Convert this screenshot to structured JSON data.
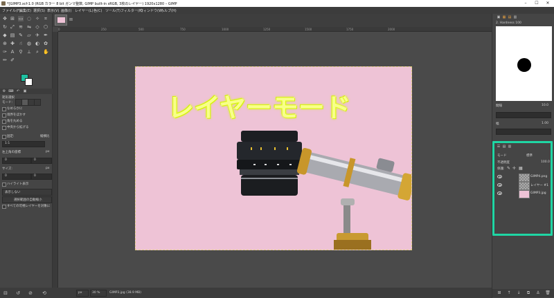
{
  "window": {
    "title": "*[GIMP3.xcf-1.0 (RGB カラー 8 bit ガンマ整数, GIMP built-in sRGB, 3枚のレイヤー) 1920x1280 – GIMP",
    "controls": [
      "–",
      "☐",
      "✕"
    ]
  },
  "menu": [
    "ファイル(F)",
    "編集(E)",
    "選択(S)",
    "表示(V)",
    "画像(I)",
    "レイヤー(L)",
    "色(C)",
    "ツール(T)",
    "フィルター(R)",
    "ウィンドウ(W)",
    "ヘルプ(H)"
  ],
  "tool_options": {
    "title": "矩形選択",
    "mode_label": "モード:",
    "antialias": "なめらかに",
    "feather": "境界をぼかす",
    "rounded": "角を丸める",
    "expand_center": "中央から拡げる",
    "fixed_label": "固定:",
    "fixed_value": "縦横比",
    "ratio_value": "1:1",
    "position_label": "位置:",
    "position_unit": "px",
    "size_label": "サイズ:",
    "size_unit": "px",
    "pos_x": "0",
    "pos_y": "0",
    "size_w": "0",
    "size_h": "0",
    "highlight": "ハイライト表示",
    "guides": "表示しない",
    "auto_shrink": "選択範囲の自動縮小",
    "shrink_merged": "すべての可視レイヤーを対象に",
    "top_left_label": "左上角の座標"
  },
  "rulers": {
    "h_ticks": [
      "0",
      "250",
      "500",
      "750",
      "1000",
      "1250",
      "1500",
      "1750",
      "2000"
    ]
  },
  "image": {
    "overlay_text": "レイヤーモード"
  },
  "statusbar": {
    "unit": "px",
    "zoom": "30 %",
    "file_info": "GIMP3.jpg (38.9 MB)"
  },
  "brushes": {
    "name": "2. Hardness 100",
    "spacing_label": "間隔",
    "spacing_value": "10.0"
  },
  "tool_dock": {
    "size_label": "幅",
    "size_value": "1.00"
  },
  "layers": {
    "mode_label": "モード",
    "mode_value": "標準",
    "opacity_label": "不透明度",
    "opacity_value": "100.0",
    "lock_label": "保護:",
    "items": [
      {
        "name": "GIMP4.png"
      },
      {
        "name": "レイヤー #1"
      },
      {
        "name": "GIMP3.jpg"
      }
    ]
  },
  "colors": {
    "highlight": "#1fd6a4",
    "foreground": "#1fbfa0",
    "background": "#ffffff",
    "image_bg": "#eec3d6",
    "text_glow": "#e8ff20"
  }
}
